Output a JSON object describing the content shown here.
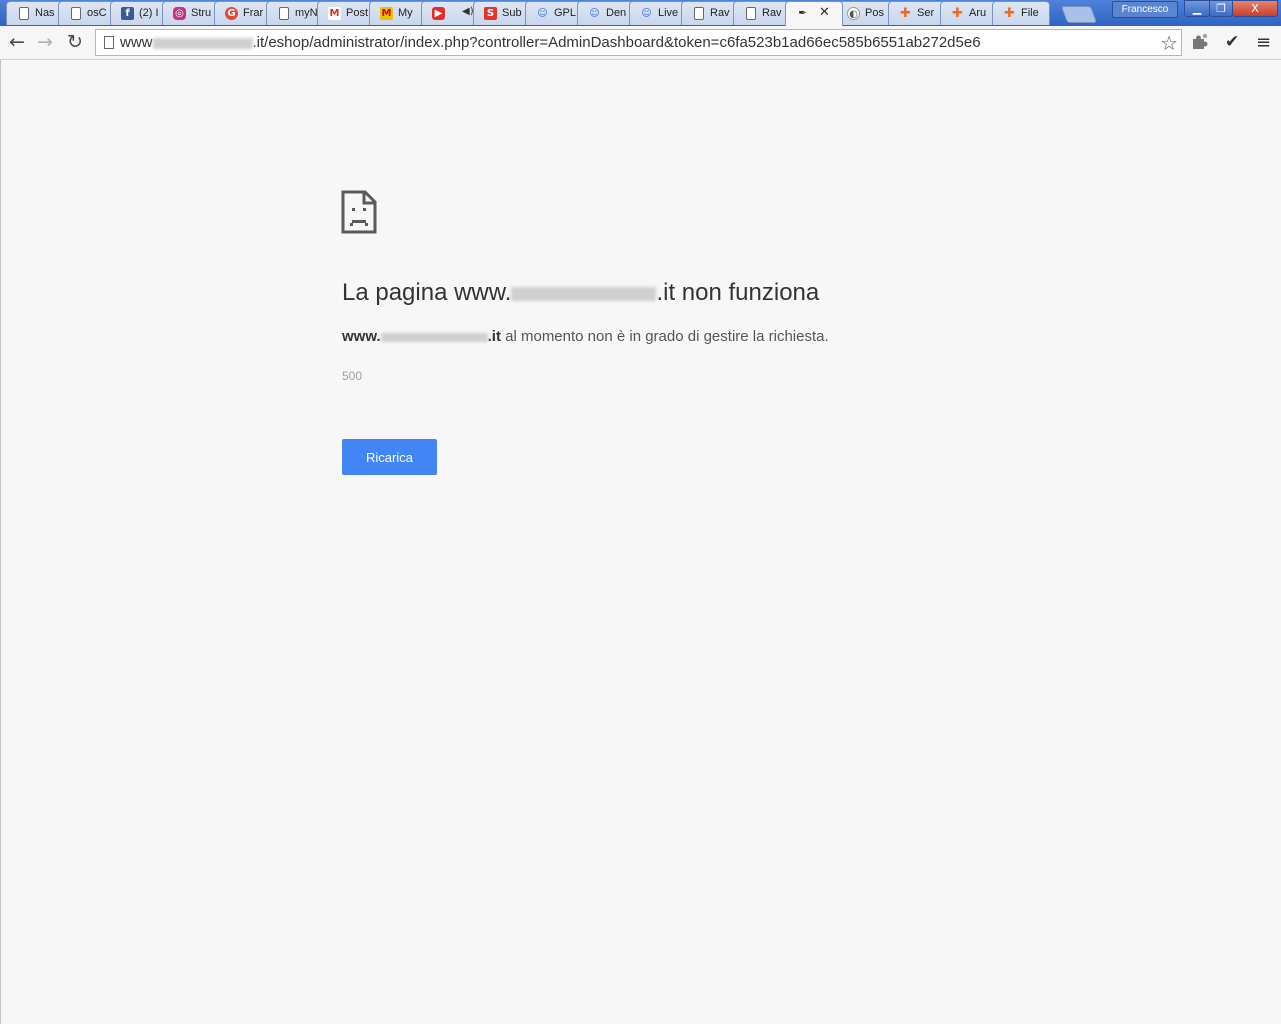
{
  "window": {
    "profile_name": "Francesco",
    "minimize_glyph": "▁",
    "maximize_glyph": "❐",
    "close_glyph": "X"
  },
  "tabs": [
    {
      "label": "Nas",
      "icon": "page-icon"
    },
    {
      "label": "osC",
      "icon": "page-icon"
    },
    {
      "label": "(2) I",
      "icon": "facebook-icon"
    },
    {
      "label": "Stru",
      "icon": "instagram-icon"
    },
    {
      "label": "Frar",
      "icon": "google-plus-icon"
    },
    {
      "label": "myN",
      "icon": "page-icon"
    },
    {
      "label": "Post",
      "icon": "gmail-icon"
    },
    {
      "label": "My",
      "icon": "my-m-icon"
    },
    {
      "label": "",
      "icon": "youtube-icon",
      "extra": "◀)"
    },
    {
      "label": "Sub",
      "icon": "subtitles-icon"
    },
    {
      "label": "GPL",
      "icon": "cat-icon"
    },
    {
      "label": "Den",
      "icon": "cat-icon"
    },
    {
      "label": "Live",
      "icon": "cat-icon"
    },
    {
      "label": "Rav",
      "icon": "page-icon"
    },
    {
      "label": "Rav",
      "icon": "page-icon"
    },
    {
      "label": "",
      "icon": "pen-icon",
      "active": true,
      "close": "✕"
    },
    {
      "label": "Pos",
      "icon": "pokeball-icon"
    },
    {
      "label": "Ser",
      "icon": "aruba-icon"
    },
    {
      "label": "Aru",
      "icon": "aruba-icon"
    },
    {
      "label": "File",
      "icon": "aruba-icon"
    }
  ],
  "toolbar": {
    "back_glyph": "←",
    "forward_glyph": "→",
    "reload_glyph": "↻",
    "url_prefix": "www",
    "url_suffix": ".it/eshop/administrator/index.php?controller=AdminDashboard&token=c6fa523b1ad66ec585b6551ab272d5e6",
    "star_glyph": "☆",
    "check_glyph": "✔",
    "menu_glyph": "≡"
  },
  "error": {
    "title_prefix": "La pagina www.",
    "title_suffix": ".it non funziona",
    "desc_host_prefix": "www.",
    "desc_host_suffix": ".it",
    "desc_text": " al momento non è in grado di gestire la richiesta.",
    "code": "500",
    "reload_label": "Ricarica"
  },
  "colors": {
    "accent": "#4285f4",
    "page_bg": "#f7f7f7",
    "titlebar": "#2f63c4"
  }
}
